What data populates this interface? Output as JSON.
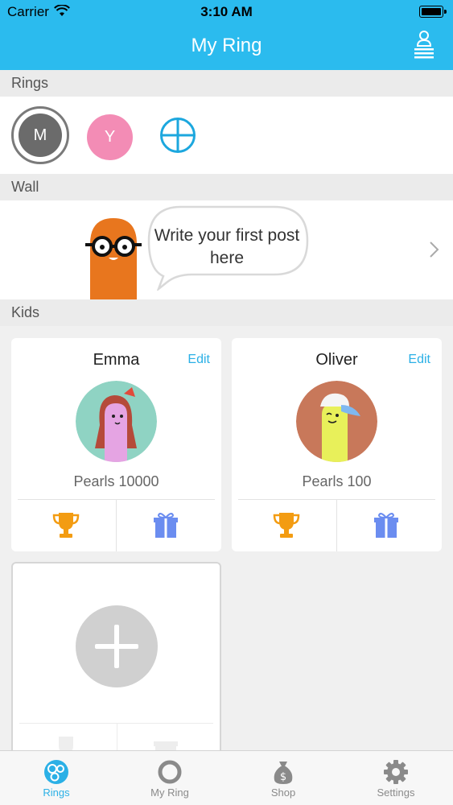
{
  "status_bar": {
    "carrier": "Carrier",
    "time": "3:10 AM"
  },
  "nav": {
    "title": "My Ring",
    "profile_icon": "profile-stack-icon"
  },
  "sections": {
    "rings": "Rings",
    "wall": "Wall",
    "kids": "Kids"
  },
  "rings": {
    "items": [
      {
        "initial": "M",
        "color": "#6b6b6b",
        "selected": true
      },
      {
        "initial": "Y",
        "color": "#f38cb5",
        "selected": false
      }
    ],
    "add_icon": "add-circle-icon"
  },
  "wall": {
    "prompt": "Write your first post here"
  },
  "kids": [
    {
      "name": "Emma",
      "edit_label": "Edit",
      "pearls": "Pearls 10000",
      "avatar_bg": "#8fd3c3"
    },
    {
      "name": "Oliver",
      "edit_label": "Edit",
      "pearls": "Pearls 100",
      "avatar_bg": "#c8785a"
    }
  ],
  "tabs": [
    {
      "label": "Rings",
      "active": true
    },
    {
      "label": "My Ring",
      "active": false
    },
    {
      "label": "Shop",
      "active": false
    },
    {
      "label": "Settings",
      "active": false
    }
  ],
  "colors": {
    "brand": "#2bbbee",
    "accent": "#2bb0e6",
    "trophy": "#f39c12",
    "gift": "#6b8df0"
  }
}
